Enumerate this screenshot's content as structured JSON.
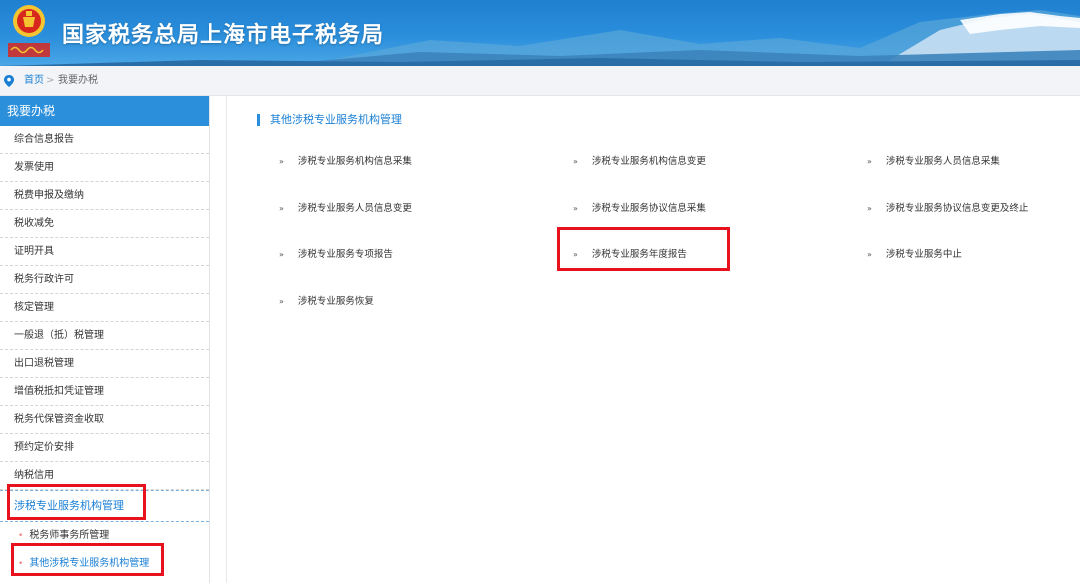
{
  "header": {
    "title": "国家税务总局上海市电子税务局"
  },
  "breadcrumb": {
    "home": "首页",
    "separator": ">",
    "current": "我要办税"
  },
  "sidebar": {
    "heading": "我要办税",
    "items": [
      "综合信息报告",
      "发票使用",
      "税费申报及缴纳",
      "税收减免",
      "证明开具",
      "税务行政许可",
      "核定管理",
      "一般退（抵）税管理",
      "出口退税管理",
      "增值税抵扣凭证管理",
      "税务代保管资金收取",
      "预约定价安排",
      "纳税信用"
    ],
    "group": "涉税专业服务机构管理",
    "sub_items": [
      "税务师事务所管理",
      "其他涉税专业服务机构管理"
    ]
  },
  "main": {
    "section_title": "其他涉税专业服务机构管理",
    "links": [
      "涉税专业服务机构信息采集",
      "涉税专业服务机构信息变更",
      "涉税专业服务人员信息采集",
      "涉税专业服务人员信息变更",
      "涉税专业服务协议信息采集",
      "涉税专业服务协议信息变更及终止",
      "涉税专业服务专项报告",
      "涉税专业服务年度报告",
      "涉税专业服务中止",
      "涉税专业服务恢复"
    ]
  },
  "colors": {
    "brand_blue": "#2b8fdc",
    "link_blue": "#1a7fd4",
    "highlight_red": "#e8121f"
  }
}
